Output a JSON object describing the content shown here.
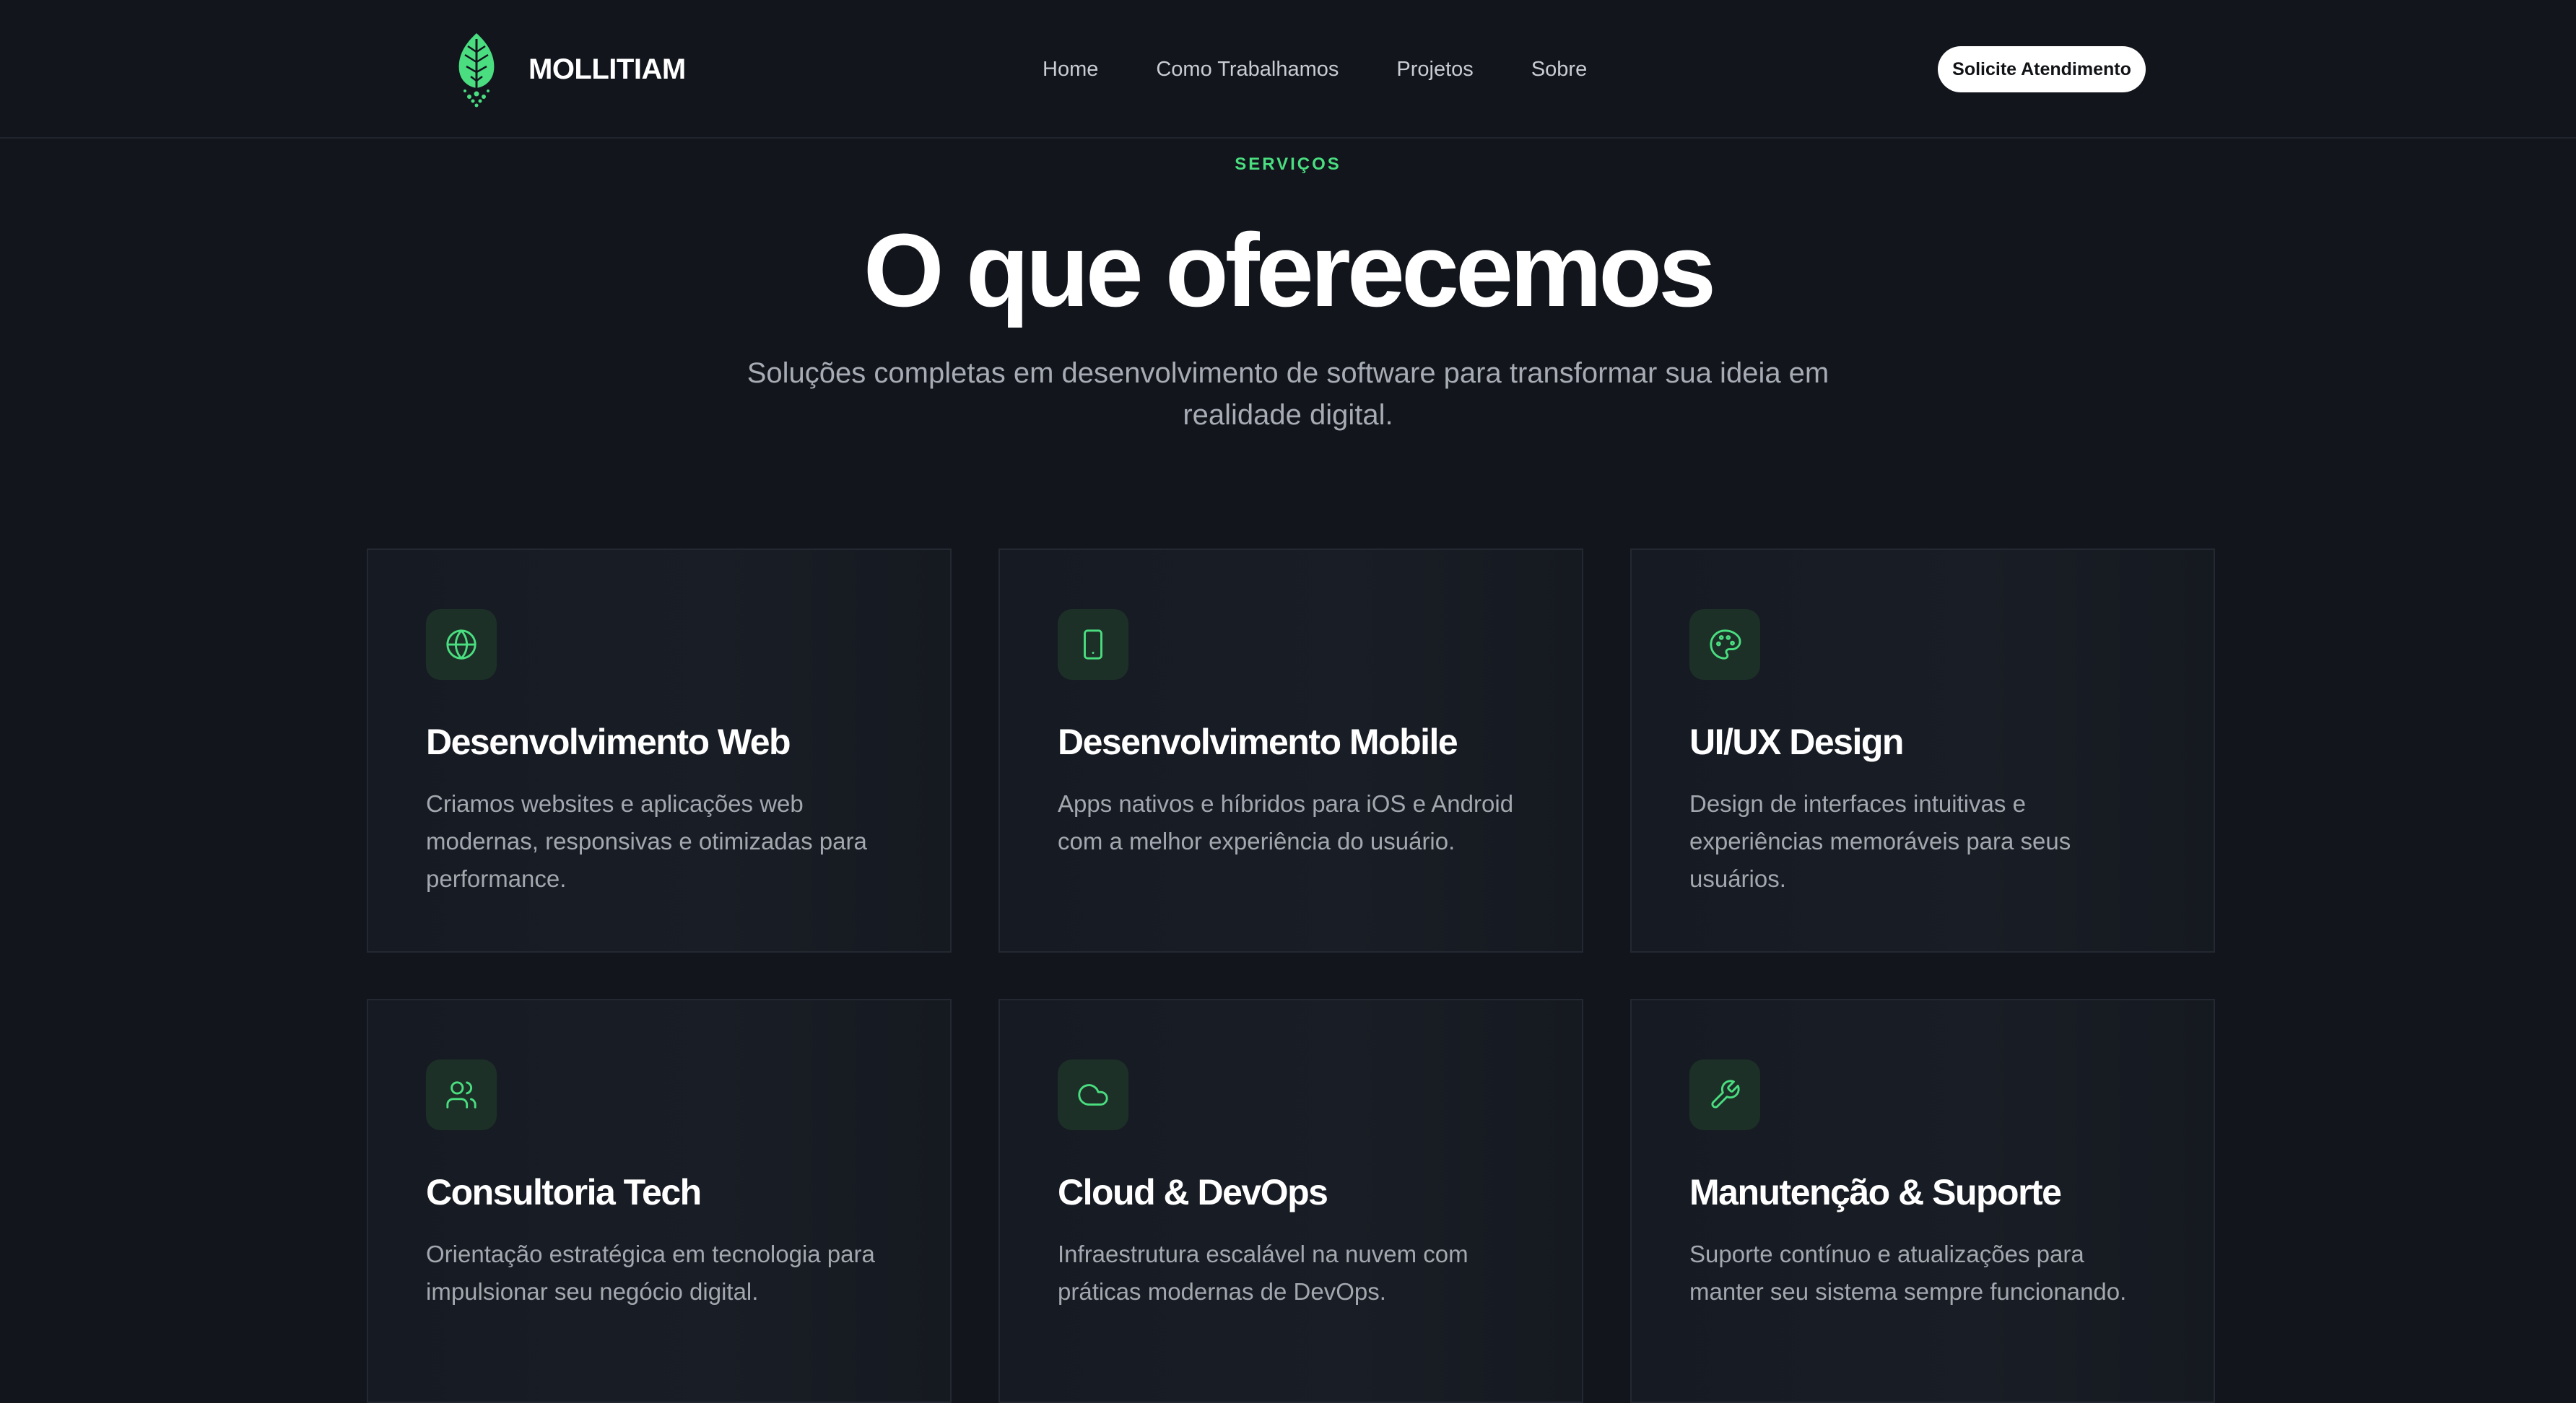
{
  "header": {
    "brand": "MOLLITIAM",
    "nav": [
      {
        "label": "Home"
      },
      {
        "label": "Como Trabalhamos"
      },
      {
        "label": "Projetos"
      },
      {
        "label": "Sobre"
      }
    ],
    "cta_label": "Solicite Atendimento"
  },
  "hero": {
    "eyebrow": "SERVIÇOS",
    "title": "O que oferecemos",
    "subtitle": "Soluções completas em desenvolvimento de software para transformar sua ideia em realidade digital."
  },
  "services": [
    {
      "icon": "globe-icon",
      "title": "Desenvolvimento Web",
      "description": "Criamos websites e aplicações web modernas, responsivas e otimizadas para performance."
    },
    {
      "icon": "smartphone-icon",
      "title": "Desenvolvimento Mobile",
      "description": "Apps nativos e híbridos para iOS e Android com a melhor experiência do usuário."
    },
    {
      "icon": "palette-icon",
      "title": "UI/UX Design",
      "description": "Design de interfaces intuitivas e experiências memoráveis para seus usuários."
    },
    {
      "icon": "users-icon",
      "title": "Consultoria Tech",
      "description": "Orientação estratégica em tecnologia para impulsionar seu negócio digital."
    },
    {
      "icon": "cloud-icon",
      "title": "Cloud & DevOps",
      "description": "Infraestrutura escalável na nuvem com práticas modernas de DevOps."
    },
    {
      "icon": "wrench-icon",
      "title": "Manutenção & Suporte",
      "description": "Suporte contínuo e atualizações para manter seu sistema sempre funcionando."
    }
  ],
  "colors": {
    "background": "#12151c",
    "accent": "#4ade80",
    "card_background": "#181c24",
    "icon_tile": "#1c3027",
    "muted_text": "#a3a7ae"
  }
}
